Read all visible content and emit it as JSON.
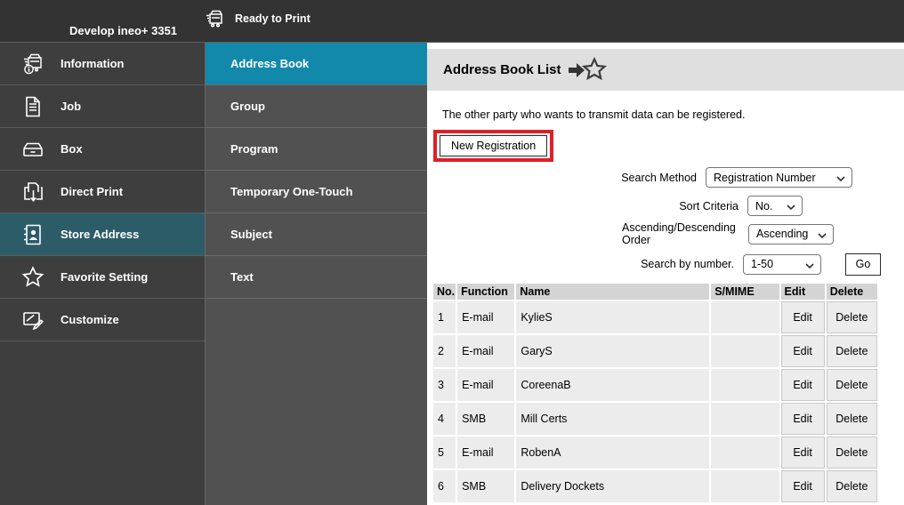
{
  "top_bar": {
    "device_name": "Develop ineo+ 3351",
    "status": "Ready to Print"
  },
  "sidebar": {
    "items": [
      {
        "label": "Information",
        "icon": "printer-info-icon",
        "selected": false
      },
      {
        "label": "Job",
        "icon": "document-icon",
        "selected": false
      },
      {
        "label": "Box",
        "icon": "box-tray-icon",
        "selected": false
      },
      {
        "label": "Direct Print",
        "icon": "direct-print-icon",
        "selected": false
      },
      {
        "label": "Store Address",
        "icon": "address-book-icon",
        "selected": true
      },
      {
        "label": "Favorite Setting",
        "icon": "star-icon",
        "selected": false
      },
      {
        "label": "Customize",
        "icon": "customize-icon",
        "selected": false
      }
    ]
  },
  "submenu": {
    "items": [
      {
        "label": "Address Book",
        "selected": true
      },
      {
        "label": "Group",
        "selected": false
      },
      {
        "label": "Program",
        "selected": false
      },
      {
        "label": "Temporary One-Touch",
        "selected": false
      },
      {
        "label": "Subject",
        "selected": false
      },
      {
        "label": "Text",
        "selected": false
      }
    ]
  },
  "main": {
    "title": "Address Book List",
    "description": "The other party who wants to transmit data can be registered.",
    "new_registration_label": "New Registration",
    "search": {
      "method_label": "Search Method",
      "method_value": "Registration Number",
      "sort_label": "Sort Criteria",
      "sort_value": "No.",
      "order_label": "Ascending/Descending Order",
      "order_value": "Ascending",
      "number_label": "Search by number.",
      "number_value": "1-50",
      "go_label": "Go"
    },
    "table": {
      "headers": [
        "No.",
        "Function",
        "Name",
        "S/MIME",
        "Edit",
        "Delete"
      ],
      "rows": [
        {
          "no": "1",
          "function": "E-mail",
          "name": "KylieS",
          "smime": "",
          "edit": "Edit",
          "delete": "Delete"
        },
        {
          "no": "2",
          "function": "E-mail",
          "name": "GaryS",
          "smime": "",
          "edit": "Edit",
          "delete": "Delete"
        },
        {
          "no": "3",
          "function": "E-mail",
          "name": "CoreenaB",
          "smime": "",
          "edit": "Edit",
          "delete": "Delete"
        },
        {
          "no": "4",
          "function": "SMB",
          "name": "Mill Certs",
          "smime": "",
          "edit": "Edit",
          "delete": "Delete"
        },
        {
          "no": "5",
          "function": "E-mail",
          "name": "RobenA",
          "smime": "",
          "edit": "Edit",
          "delete": "Delete"
        },
        {
          "no": "6",
          "function": "SMB",
          "name": "Delivery Dockets",
          "smime": "",
          "edit": "Edit",
          "delete": "Delete"
        }
      ]
    }
  },
  "colors": {
    "topbar_bg": "#333333",
    "sidebar_bg": "#3e3e3e",
    "sidebar_selected": "#2d5c69",
    "submenu_bg": "#515151",
    "submenu_selected": "#1289ab",
    "band_bg": "#dfdfdf",
    "annotation_red": "#e01f26"
  }
}
